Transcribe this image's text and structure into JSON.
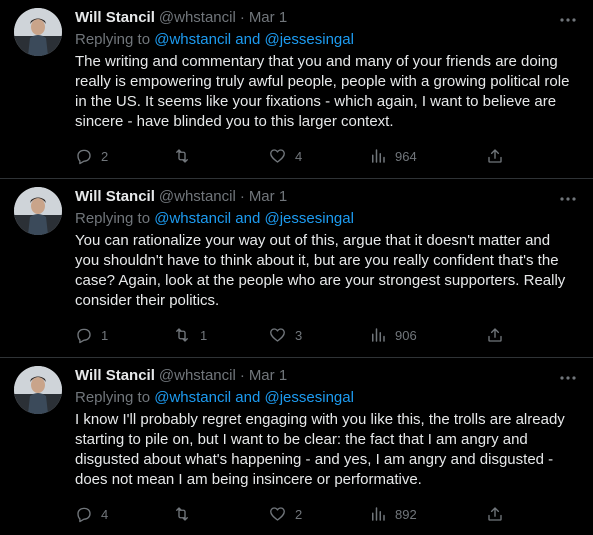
{
  "tweets": [
    {
      "name": "Will Stancil",
      "handle": "@whstancil",
      "dot": "·",
      "date": "Mar 1",
      "replying_prefix": "Replying to ",
      "replying_mentions": "@whstancil and @jessesingal",
      "text": "The writing and commentary that you and many of your friends are doing really is empowering truly awful people, people with a growing political role in the US. It seems like your fixations - which again, I want to believe are sincere - have blinded you to this larger context.",
      "replies": "2",
      "retweets": "",
      "likes": "4",
      "views": "964"
    },
    {
      "name": "Will Stancil",
      "handle": "@whstancil",
      "dot": "·",
      "date": "Mar 1",
      "replying_prefix": "Replying to ",
      "replying_mentions": "@whstancil and @jessesingal",
      "text": "You can rationalize your way out of this, argue that it doesn't matter and you shouldn't have to think about it, but are you really confident that's the case? Again, look at the people who are your strongest supporters. Really consider their politics.",
      "replies": "1",
      "retweets": "1",
      "likes": "3",
      "views": "906"
    },
    {
      "name": "Will Stancil",
      "handle": "@whstancil",
      "dot": "·",
      "date": "Mar 1",
      "replying_prefix": "Replying to ",
      "replying_mentions": "@whstancil and @jessesingal",
      "text": "I know I'll probably regret engaging with you like this, the trolls are already starting to pile on, but I want to be clear: the fact that I am angry and disgusted about what's happening - and yes, I am angry and disgusted - does not mean I am being insincere or performative.",
      "replies": "4",
      "retweets": "",
      "likes": "2",
      "views": "892"
    }
  ],
  "icons": {
    "more": "more-horizontal-icon",
    "reply": "reply-bubble-icon",
    "retweet": "retweet-icon",
    "like": "heart-icon",
    "views": "views-bar-chart-icon",
    "share": "share-upload-icon"
  },
  "colors": {
    "background": "#000000",
    "text": "#e7e9ea",
    "muted": "#71767b",
    "link": "#1d9bf0",
    "divider": "#2f3336"
  }
}
